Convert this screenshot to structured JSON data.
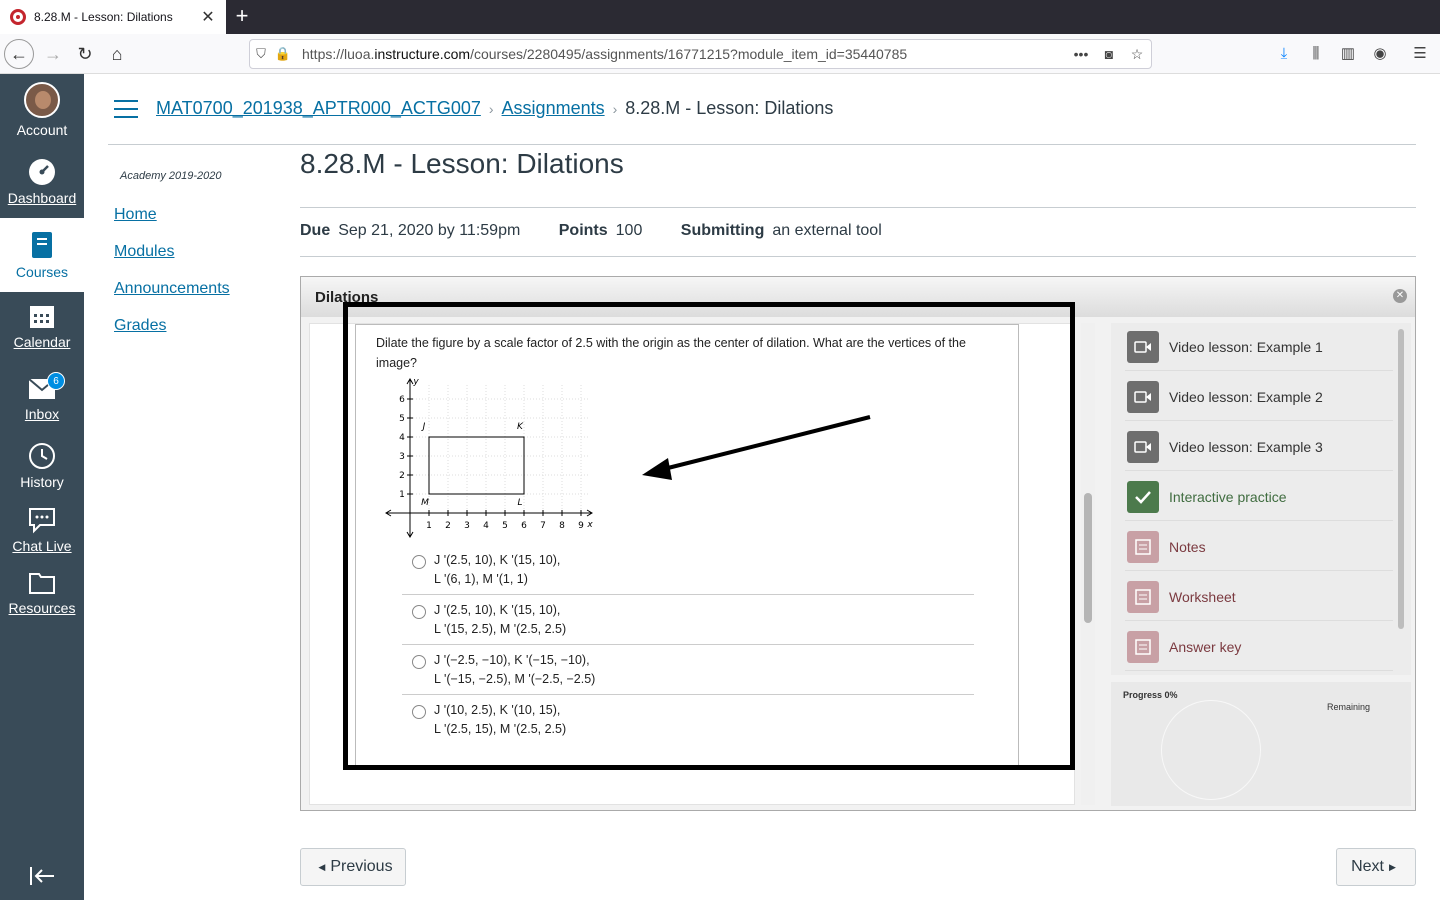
{
  "browser": {
    "tab_title": "8.28.M - Lesson: Dilations",
    "url_prefix": "https://luoa.",
    "url_host": "instructure.com",
    "url_path": "/courses/2280495/assignments/16771215?module_item_id=35440785"
  },
  "global_nav": {
    "account": "Account",
    "dashboard": "Dashboard",
    "courses": "Courses",
    "calendar": "Calendar",
    "inbox": "Inbox",
    "inbox_badge": "6",
    "history": "History",
    "chat_live": "Chat Live",
    "resources": "Resources"
  },
  "breadcrumb": {
    "course": "MAT0700_201938_APTR000_ACTG007",
    "assignments": "Assignments",
    "current": "8.28.M - Lesson: Dilations"
  },
  "course_nav": {
    "term": "Academy 2019-2020",
    "items": [
      "Home",
      "Modules",
      "Announcements",
      "Grades"
    ]
  },
  "assignment": {
    "title": "8.28.M - Lesson: Dilations",
    "due_label": "Due",
    "due_value": "Sep 21, 2020 by 11:59pm",
    "points_label": "Points",
    "points_value": "100",
    "submitting_label": "Submitting",
    "submitting_value": "an external tool"
  },
  "tool": {
    "title": "Dilations",
    "question": "Dilate the figure by a scale factor of 2.5 with the origin as the center of dilation. What are the vertices of the image?",
    "graph": {
      "y_label": "y",
      "x_label": "x",
      "y_ticks": [
        "1",
        "2",
        "3",
        "4",
        "5",
        "6"
      ],
      "x_ticks": [
        "1",
        "2",
        "3",
        "4",
        "5",
        "6",
        "7",
        "8",
        "9"
      ],
      "vertices": [
        "J",
        "K",
        "L",
        "M"
      ]
    },
    "options": [
      {
        "l1": "J '(2.5, 10), K '(15, 10),",
        "l2": "L '(6, 1), M '(1, 1)"
      },
      {
        "l1": "J '(2.5, 10), K '(15, 10),",
        "l2": "L '(15, 2.5), M '(2.5, 2.5)"
      },
      {
        "l1": "J '(−2.5, −10), K '(−15, −10),",
        "l2": "L '(−15, −2.5), M '(−2.5, −2.5)"
      },
      {
        "l1": "J '(10, 2.5), K '(10, 15),",
        "l2": "L '(2.5, 15), M '(2.5, 2.5)"
      }
    ],
    "side_items": [
      {
        "label": "Video lesson: Example 1",
        "kind": "video"
      },
      {
        "label": "Video lesson: Example 2",
        "kind": "video"
      },
      {
        "label": "Video lesson: Example 3",
        "kind": "video"
      },
      {
        "label": "Interactive practice",
        "kind": "done"
      },
      {
        "label": "Notes",
        "kind": "res"
      },
      {
        "label": "Worksheet",
        "kind": "res"
      },
      {
        "label": "Answer key",
        "kind": "res"
      }
    ],
    "progress_label": "Progress 0%",
    "remaining_label": "Remaining"
  },
  "footer": {
    "previous": "Previous",
    "next": "Next"
  }
}
